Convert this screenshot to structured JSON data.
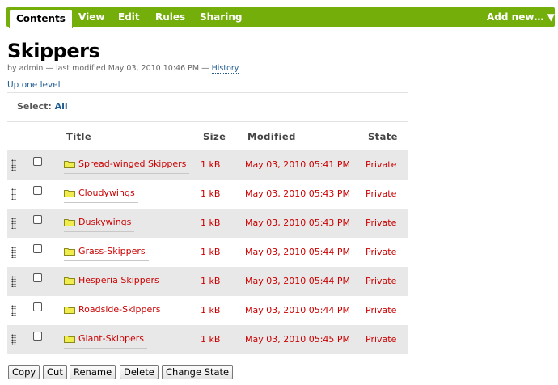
{
  "tabs": {
    "contents": "Contents",
    "view": "View",
    "edit": "Edit",
    "rules": "Rules",
    "sharing": "Sharing",
    "add_new": "Add new… ▼"
  },
  "page": {
    "title": "Skippers",
    "byline_prefix": "by admin — last modified May 03, 2010 10:46 PM — ",
    "history_link": "History",
    "up_one_level": "Up one level"
  },
  "select": {
    "label": "Select:",
    "all": "All"
  },
  "table": {
    "headers": {
      "title": "Title",
      "size": "Size",
      "modified": "Modified",
      "state": "State"
    },
    "rows": [
      {
        "title": "Spread-winged Skippers",
        "size": "1 kB",
        "modified": "May 03, 2010 05:41 PM",
        "state": "Private"
      },
      {
        "title": "Cloudywings",
        "size": "1 kB",
        "modified": "May 03, 2010 05:43 PM",
        "state": "Private"
      },
      {
        "title": "Duskywings",
        "size": "1 kB",
        "modified": "May 03, 2010 05:43 PM",
        "state": "Private"
      },
      {
        "title": "Grass-Skippers",
        "size": "1 kB",
        "modified": "May 03, 2010 05:44 PM",
        "state": "Private"
      },
      {
        "title": "Hesperia Skippers",
        "size": "1 kB",
        "modified": "May 03, 2010 05:44 PM",
        "state": "Private"
      },
      {
        "title": "Roadside-Skippers",
        "size": "1 kB",
        "modified": "May 03, 2010 05:44 PM",
        "state": "Private"
      },
      {
        "title": "Giant-Skippers",
        "size": "1 kB",
        "modified": "May 03, 2010 05:45 PM",
        "state": "Private"
      }
    ]
  },
  "buttons": {
    "copy": "Copy",
    "cut": "Cut",
    "rename": "Rename",
    "delete": "Delete",
    "change_state": "Change State"
  },
  "colors": {
    "tabbar": "#74ae0b",
    "link": "#205c90",
    "item_text": "#cc0000",
    "row_stripe": "#e8e8e8"
  }
}
